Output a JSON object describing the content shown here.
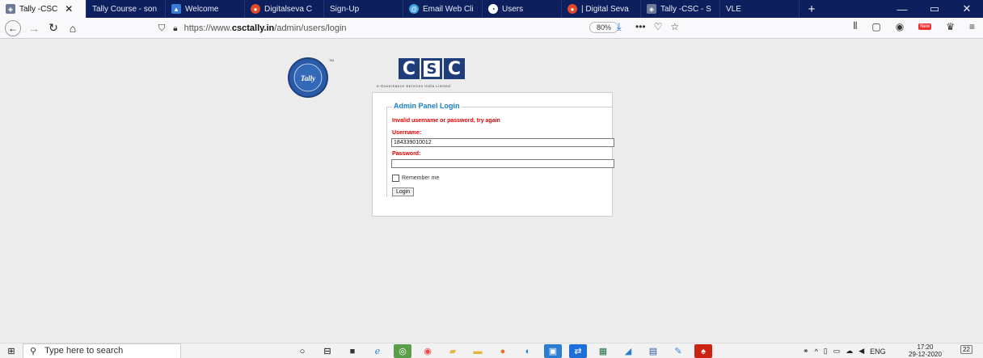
{
  "browser": {
    "tabs": [
      {
        "label": "Tally -CSC",
        "icon": "tally-icon",
        "active": true
      },
      {
        "label": "Tally Course - son",
        "icon": "",
        "active": false
      },
      {
        "label": "Welcome",
        "icon": "image-icon",
        "active": false
      },
      {
        "label": "Digitalseva C",
        "icon": "digitalseva-icon",
        "active": false
      },
      {
        "label": "Sign-Up",
        "icon": "",
        "active": false
      },
      {
        "label": "Email Web Cli",
        "icon": "email-icon",
        "active": false
      },
      {
        "label": "Users",
        "icon": "users-icon",
        "active": false
      },
      {
        "label": "| Digital Seva",
        "icon": "digitalseva-icon",
        "active": false
      },
      {
        "label": "Tally -CSC - S",
        "icon": "tally-icon",
        "active": false
      },
      {
        "label": "VLE",
        "icon": "",
        "active": false
      }
    ],
    "url_prefix": "https://www.",
    "url_domain": "csctally.in",
    "url_path": "/admin/users/login",
    "zoom": "80%",
    "new_badge": "New"
  },
  "login": {
    "legend": "Admin Panel Login",
    "error": "Invalid username or password, try again",
    "username_label": "Username:",
    "username_value": "184339010012",
    "password_label": "Password:",
    "password_value": "",
    "remember_label": "Remember me",
    "login_button": "Login"
  },
  "logos": {
    "tally_text": "Tally",
    "csc_letters": [
      "C",
      "S",
      "C"
    ],
    "csc_subtitle": "e-Governance Services India Limited"
  },
  "taskbar": {
    "search_placeholder": "Type here to search",
    "lang": "ENG",
    "time": "17:20",
    "date": "29-12-2020",
    "notifications": "22"
  },
  "colors": {
    "tabbar_bg": "#0d1f5c",
    "legend": "#1a7fc1",
    "error": "#dd0000",
    "csc_blue": "#1f3d7a"
  }
}
